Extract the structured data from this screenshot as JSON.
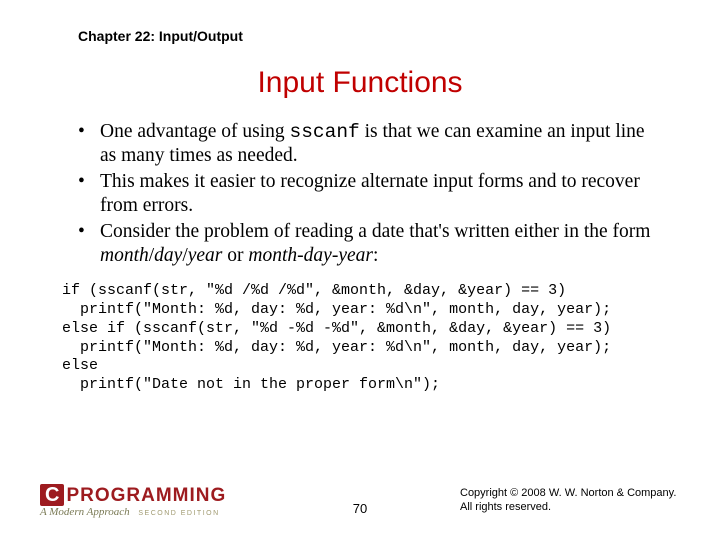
{
  "chapter": "Chapter 22: Input/Output",
  "title": "Input Functions",
  "bullets": [
    {
      "pre": "One advantage of using ",
      "code": "sscanf",
      "post": " is that we can examine an input line as many times as needed."
    },
    {
      "pre": "This makes it easier to recognize alternate input forms and to recover from errors.",
      "code": "",
      "post": ""
    },
    {
      "pre": "Consider the problem of reading a date that's written either in the form ",
      "code": "",
      "post": "",
      "tail_italic_1": "month",
      "sep1": "/",
      "tail_italic_2": "day",
      "sep2": "/",
      "tail_italic_3": "year",
      "mid": " or ",
      "tail_italic_4": "month",
      "sep3": "-",
      "tail_italic_5": "day",
      "sep4": "-",
      "tail_italic_6": "year",
      "end": ":"
    }
  ],
  "code_lines": [
    "if (sscanf(str, \"%d /%d /%d\", &month, &day, &year) == 3)",
    "  printf(\"Month: %d, day: %d, year: %d\\n\", month, day, year);",
    "else if (sscanf(str, \"%d -%d -%d\", &month, &day, &year) == 3)",
    "  printf(\"Month: %d, day: %d, year: %d\\n\", month, day, year);",
    "else",
    "  printf(\"Date not in the proper form\\n\");"
  ],
  "logo": {
    "c": "C",
    "word": "PROGRAMMING",
    "sub": "A Modern Approach",
    "ed": "SECOND EDITION"
  },
  "page": "70",
  "copyright_l1": "Copyright © 2008 W. W. Norton & Company.",
  "copyright_l2": "All rights reserved."
}
